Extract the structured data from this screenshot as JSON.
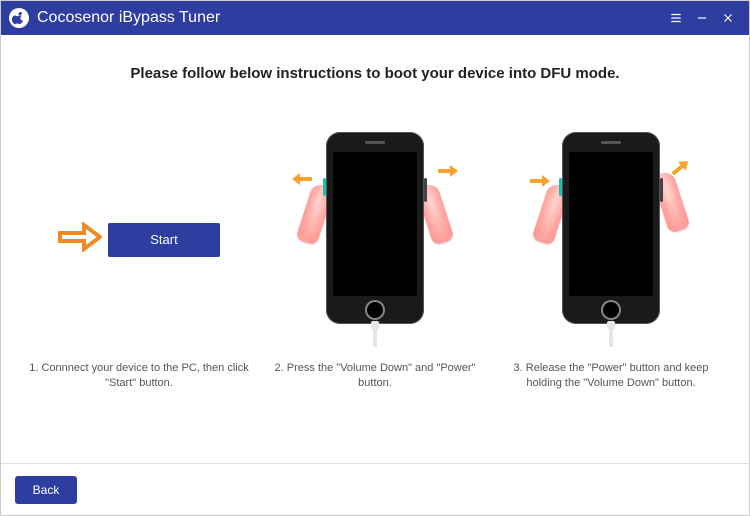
{
  "app": {
    "title": "Cocosenor iBypass Tuner"
  },
  "window_controls": {
    "menu": "menu",
    "minimize": "minimize",
    "close": "close"
  },
  "heading": "Please follow below instructions to boot your device into DFU mode.",
  "steps": {
    "start_button": "Start",
    "caption1": "1. Connnect your device to the PC, then click \"Start\" button.",
    "caption2": "2. Press the \"Volume Down\" and \"Power\" button.",
    "caption3": "3. Release the \"Power\" button and keep holding the \"Volume Down\" button."
  },
  "footer": {
    "back": "Back"
  },
  "colors": {
    "primary": "#2e3da0",
    "arrow": "#f08a24"
  }
}
